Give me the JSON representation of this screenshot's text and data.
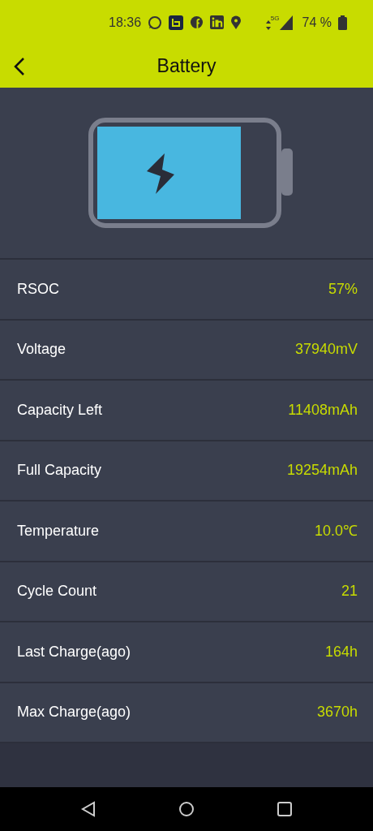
{
  "status_bar": {
    "time": "18:36",
    "network": "5G",
    "battery_percent": "74 %"
  },
  "header": {
    "title": "Battery"
  },
  "rows": [
    {
      "label": "RSOC",
      "value": "57%"
    },
    {
      "label": "Voltage",
      "value": "37940mV"
    },
    {
      "label": "Capacity Left",
      "value": "11408mAh"
    },
    {
      "label": "Full Capacity",
      "value": "19254mAh"
    },
    {
      "label": "Temperature",
      "value": "10.0℃"
    },
    {
      "label": "Cycle Count",
      "value": "21"
    },
    {
      "label": "Last Charge(ago)",
      "value": "164h"
    },
    {
      "label": "Max Charge(ago)",
      "value": "3670h"
    }
  ]
}
